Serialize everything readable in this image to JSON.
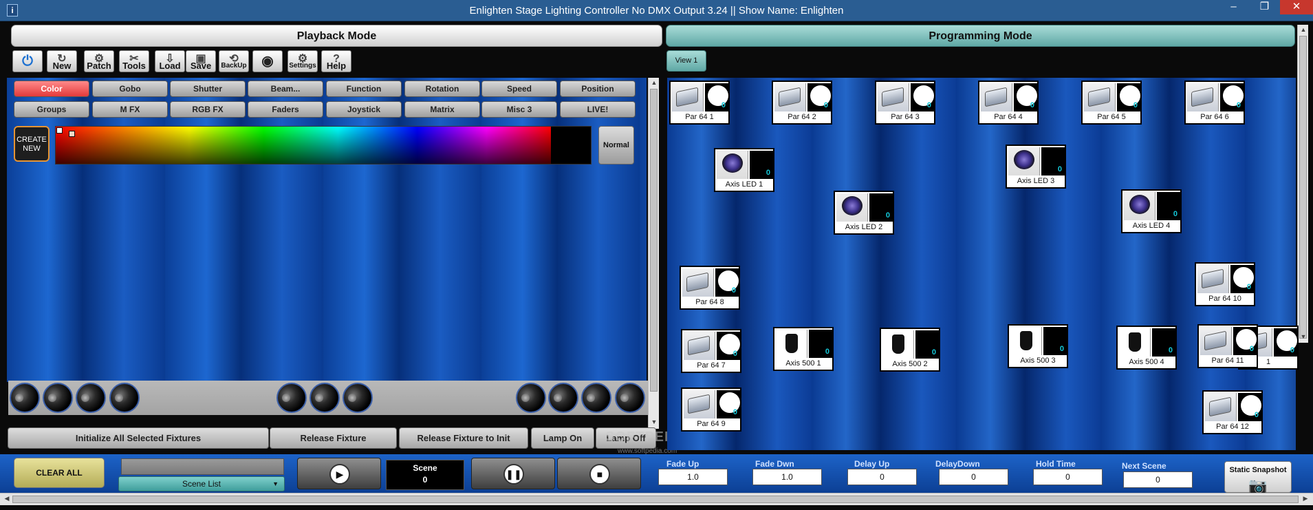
{
  "window": {
    "title": "Enlighten Stage Lighting Controller No DMX Output 3.24 || Show Name: Enlighten",
    "icon_text": "i",
    "minimize": "–",
    "restore": "❐",
    "close": "✕"
  },
  "modes": {
    "playback": "Playback Mode",
    "programming": "Programming Mode"
  },
  "toolbar": [
    {
      "label": "",
      "icon": "power-icon"
    },
    {
      "label": "New",
      "icon": "refresh-icon"
    },
    {
      "label": "Patch",
      "icon": "patch-icon"
    },
    {
      "label": "Tools",
      "icon": "tools-icon"
    },
    {
      "label": "Load",
      "icon": "load-icon"
    },
    {
      "label": "Save",
      "icon": "save-icon"
    },
    {
      "label": "BackUp",
      "icon": "backup-icon"
    },
    {
      "label": "",
      "icon": "eye-icon"
    },
    {
      "label": "Settings",
      "icon": "settings-icon"
    },
    {
      "label": "Help",
      "icon": "help-icon"
    }
  ],
  "view_button": "View 1",
  "categories_row1": [
    "Color",
    "Gobo",
    "Shutter",
    "Beam...",
    "Function",
    "Rotation",
    "Speed",
    "Position"
  ],
  "categories_row2": [
    "Groups",
    "M FX",
    "RGB FX",
    "Faders",
    "Joystick",
    "Matrix",
    "Misc 3",
    "LIVE!"
  ],
  "create_new": {
    "line1": "CREATE",
    "line2": "NEW"
  },
  "normal_button": "Normal",
  "actions": [
    "Initialize All Selected Fixtures",
    "Release Fixture",
    "Release Fixture to Init",
    "Lamp On",
    "Lamp Off"
  ],
  "fixtures": [
    {
      "name": "Par 64 1",
      "kind": "par",
      "level": "0"
    },
    {
      "name": "Par 64 2",
      "kind": "par",
      "level": "0"
    },
    {
      "name": "Par 64 3",
      "kind": "par",
      "level": "0"
    },
    {
      "name": "Par 64 4",
      "kind": "par",
      "level": "0"
    },
    {
      "name": "Par 64 5",
      "kind": "par",
      "level": "0"
    },
    {
      "name": "Par 64 6",
      "kind": "par",
      "level": "0"
    },
    {
      "name": "Axis LED 1",
      "kind": "led",
      "level": "0"
    },
    {
      "name": "Axis LED 3",
      "kind": "led",
      "level": "0"
    },
    {
      "name": "Axis LED 2",
      "kind": "led",
      "level": "0"
    },
    {
      "name": "Axis LED 4",
      "kind": "led",
      "level": "0"
    },
    {
      "name": "Par 64 8",
      "kind": "par",
      "level": "0"
    },
    {
      "name": "Par 64 10",
      "kind": "par",
      "level": "0"
    },
    {
      "name": "Par 64 7",
      "kind": "par",
      "level": "0"
    },
    {
      "name": "Axis 500 1",
      "kind": "spot",
      "level": "0"
    },
    {
      "name": "Axis 500 2",
      "kind": "spot",
      "level": "0"
    },
    {
      "name": "Axis 500 3",
      "kind": "spot",
      "level": "0"
    },
    {
      "name": "Axis 500 4",
      "kind": "spot",
      "level": "0"
    },
    {
      "name": "1",
      "kind": "par",
      "level": "0"
    },
    {
      "name": "Par 64 11",
      "kind": "par",
      "level": "0"
    },
    {
      "name": "Par 64 9",
      "kind": "par",
      "level": "0"
    },
    {
      "name": "Par 64 12",
      "kind": "par",
      "level": "0"
    }
  ],
  "bottom": {
    "clear_all": "CLEAR ALL",
    "scene_list": "Scene List",
    "scene_label": "Scene",
    "scene_value": "0",
    "fade_up_label": "Fade Up",
    "fade_up": "1.0",
    "fade_down_label": "Fade Dwn",
    "fade_down": "1.0",
    "delay_up_label": "Delay Up",
    "delay_up": "0",
    "delay_down_label": "DelayDown",
    "delay_down": "0",
    "hold_time_label": "Hold Time",
    "hold_time": "0",
    "next_scene_label": "Next Scene",
    "next_scene": "0",
    "static_snapshot": "Static Snapshot"
  },
  "watermark": {
    "text": "SOFTPEDIA",
    "url": "www.softpedia.com"
  }
}
